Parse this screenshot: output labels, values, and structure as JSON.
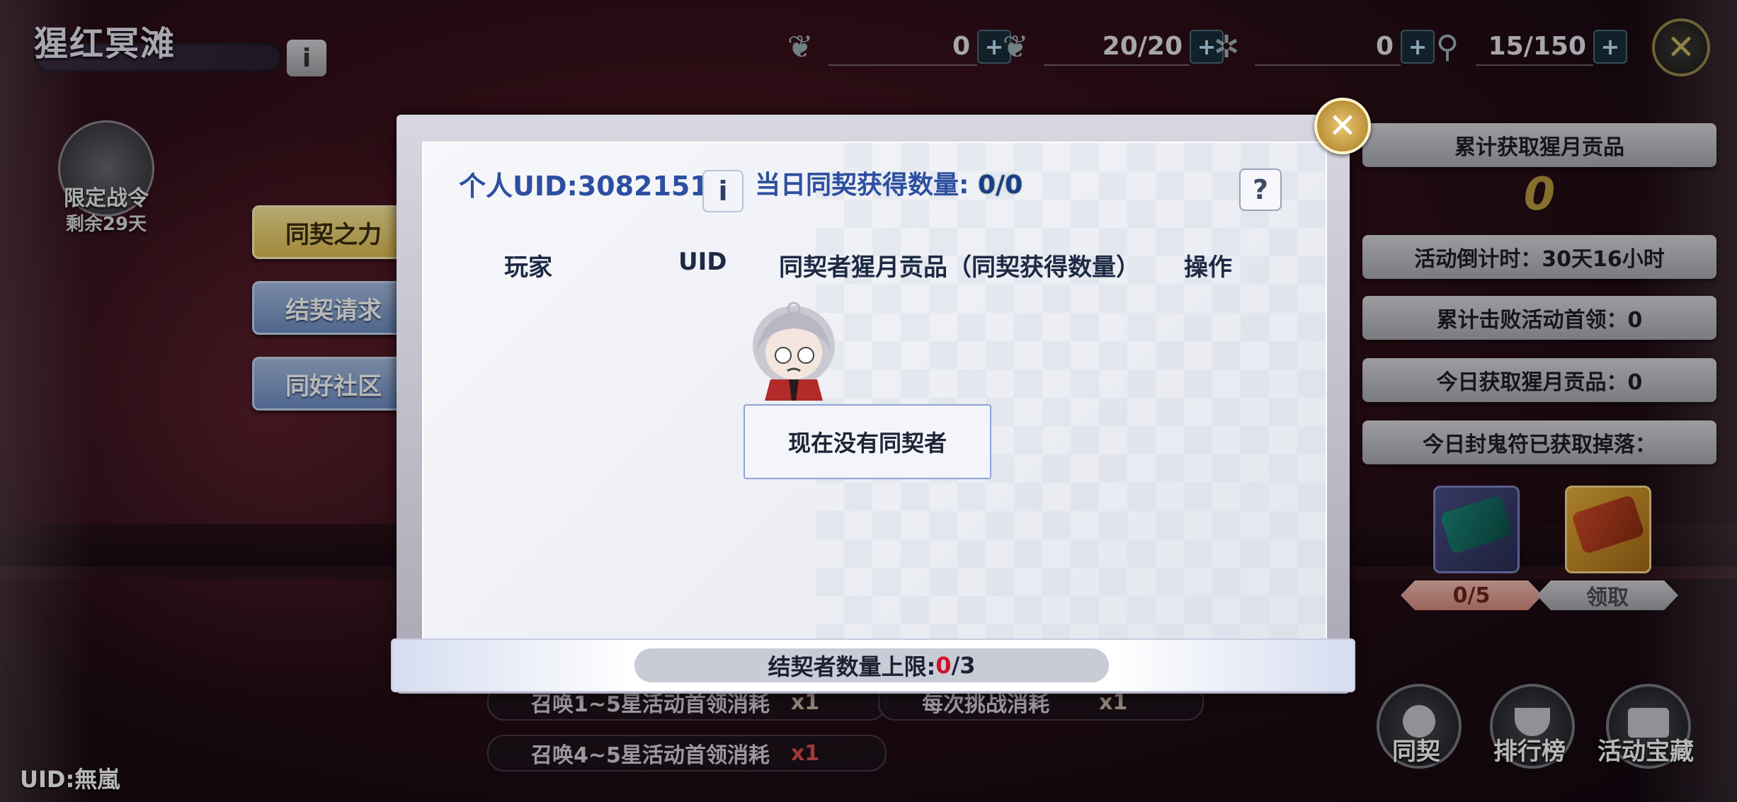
{
  "header": {
    "stage_title": "猩红冥滩",
    "resources": [
      {
        "icon": "talisman-icon",
        "value": "0"
      },
      {
        "icon": "stamina-icon",
        "value": "20/20"
      },
      {
        "icon": "spider-icon",
        "value": "0"
      },
      {
        "icon": "drumstick-icon",
        "value": "15/150"
      }
    ],
    "plus_symbol": "+",
    "close_symbol": "✕",
    "info_symbol": "i"
  },
  "left": {
    "battle_pass_title": "限定战令",
    "battle_pass_remaining": "剩余29天",
    "tabs": [
      {
        "label": "同契之力",
        "active": true
      },
      {
        "label": "结契请求",
        "active": false
      },
      {
        "label": "同好社区",
        "active": false
      }
    ],
    "bottom_uid": "UID:無嵐"
  },
  "right": {
    "total_tribute_label": "累计获取猩月贡品",
    "total_tribute_value": "0",
    "countdown": "活动倒计时：30天16小时",
    "bosses_defeated": "累计击败活动首领：0",
    "today_tribute": "今日获取猩月贡品：0",
    "today_drops": "今日封鬼符已获取掉落：",
    "reward_left_label": "0/5",
    "reward_right_label": "领取",
    "round_buttons": [
      "同契",
      "排行榜",
      "活动宝藏"
    ]
  },
  "background_rows": {
    "row1_left": "召唤1~5星活动首领消耗",
    "row1_left_count": "x1",
    "row1_right": "每次挑战消耗",
    "row1_right_count": "x1",
    "row2_left": "召唤4~5星活动首领消耗",
    "row2_left_count": "x1"
  },
  "dialog": {
    "personal_uid": "个人UID:3082151",
    "info_symbol": "i",
    "daily_label": "当日同契获得数量:",
    "daily_value": "0/0",
    "help_symbol": "?",
    "columns": [
      "玩家",
      "UID",
      "同契者猩月贡品（同契获得数量）",
      "操作"
    ],
    "empty_message": "现在没有同契者",
    "limit_label": "结契者数量上限:",
    "limit_current": "0",
    "limit_max": "/3",
    "close_symbol": "✕"
  },
  "colors": {
    "dialog_title_blue": "#2c4fa0",
    "active_tab_gold": "#e2bf52",
    "inactive_tab_blue": "#6e8ec3",
    "limit_red": "#d3102a"
  }
}
